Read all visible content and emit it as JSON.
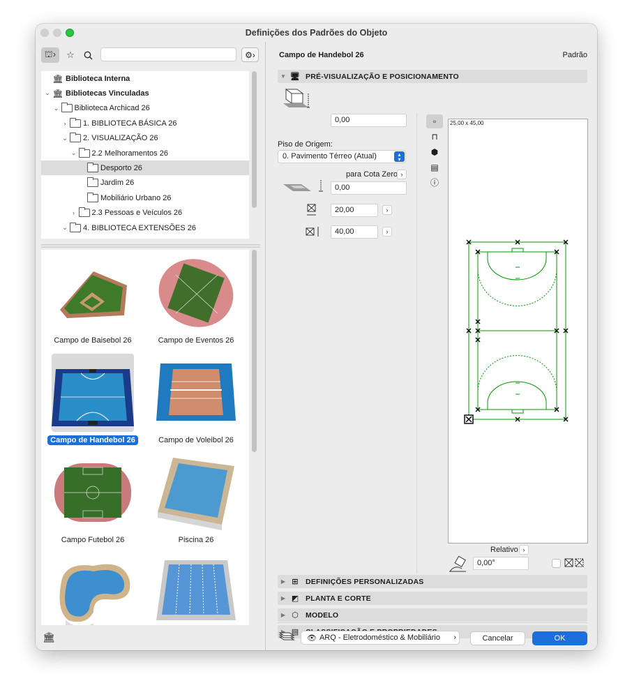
{
  "window": {
    "title": "Definições dos Padrões do Objeto"
  },
  "left": {
    "search": {
      "value": "",
      "placeholder": ""
    },
    "tree": [
      {
        "label": "Biblioteca Interna",
        "level": 0,
        "arrow": "",
        "icon": "library",
        "bold": true
      },
      {
        "label": "Bibliotecas Vinculadas",
        "level": 0,
        "arrow": "expanded",
        "icon": "library",
        "bold": true
      },
      {
        "label": "Biblioteca Archicad 26",
        "level": 1,
        "arrow": "expanded",
        "icon": "folder"
      },
      {
        "label": "1. BIBLIOTECA BÁSICA 26",
        "level": 2,
        "arrow": "collapsed",
        "icon": "folder"
      },
      {
        "label": "2. VISUALIZAÇÃO 26",
        "level": 2,
        "arrow": "expanded",
        "icon": "folder"
      },
      {
        "label": "2.2 Melhoramentos 26",
        "level": 3,
        "arrow": "expanded",
        "icon": "folder"
      },
      {
        "label": "Desporto 26",
        "level": 4,
        "arrow": "",
        "icon": "folder",
        "selected": true
      },
      {
        "label": "Jardim 26",
        "level": 4,
        "arrow": "",
        "icon": "folder"
      },
      {
        "label": "Mobiliário Urbano 26",
        "level": 4,
        "arrow": "",
        "icon": "folder"
      },
      {
        "label": "2.3 Pessoas e Veículos 26",
        "level": 3,
        "arrow": "collapsed",
        "icon": "folder"
      },
      {
        "label": "4. BIBLIOTECA EXTENSÕES 26",
        "level": 2,
        "arrow": "expanded",
        "icon": "folder"
      }
    ],
    "objects": [
      {
        "label": "Campo de Baisebol 26",
        "kind": "baseball"
      },
      {
        "label": "Campo de Eventos 26",
        "kind": "events"
      },
      {
        "label": "Campo de Handebol 26",
        "kind": "handball",
        "selected": true
      },
      {
        "label": "Campo de Voleibol 26",
        "kind": "volleyball"
      },
      {
        "label": "Campo Futebol 26",
        "kind": "football"
      },
      {
        "label": "Piscina 26",
        "kind": "pool"
      },
      {
        "label": "",
        "kind": "pool-kidney"
      },
      {
        "label": "",
        "kind": "pool-lanes"
      }
    ]
  },
  "right": {
    "object_name": "Campo de Handebol 26",
    "standard_label": "Padrão",
    "section_preview": "PRÉ-VISUALIZAÇÃO E POSICIONAMENTO",
    "elevation_value": "0,00",
    "home_story_label": "Piso de Origem:",
    "home_story_value": "0. Pavimento Térreo (Atual)",
    "to_zero_label": "para Cota Zero",
    "zero_value": "0,00",
    "width_value": "20,00",
    "depth_value": "40,00",
    "preview_dims": "25,00 x 45,00",
    "relative_label": "Relativo",
    "angle_value": "0,00°",
    "sections": [
      "DEFINIÇÕES PERSONALIZADAS",
      "PLANTA E CORTE",
      "MODELO",
      "CLASSIFICAÇÃO E PROPRIEDADES"
    ],
    "layer_value": "ARQ - Eletrodoméstico & Mobiliário",
    "cancel_label": "Cancelar",
    "ok_label": "OK",
    "accent_color": "#1c6fd8",
    "court_line_color": "#009900"
  }
}
